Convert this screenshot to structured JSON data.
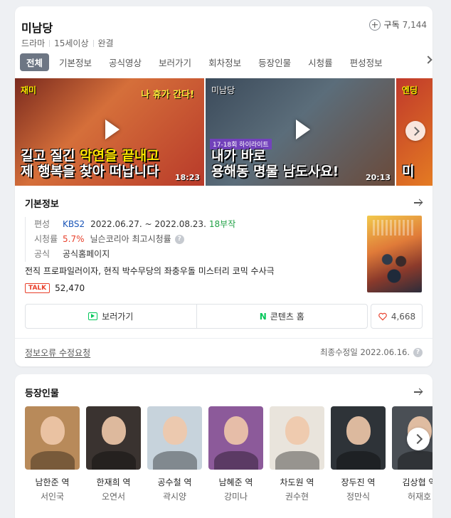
{
  "show": {
    "title": "미남당",
    "genre": "드라마",
    "rating": "15세이상",
    "status": "완결",
    "subscribe_label": "구독",
    "subscribe_count": "7,144"
  },
  "tabs": [
    "전체",
    "기본정보",
    "공식영상",
    "보러가기",
    "회차정보",
    "등장인물",
    "시청률",
    "편성정보"
  ],
  "videos": [
    {
      "tag": "재미",
      "top": "나 휴가 간다!",
      "caption_a": "길고 질긴 ",
      "caption_hl": "악연을 끝내고",
      "caption_b": "제 행복을 찾아 떠납니다",
      "duration": "18:23"
    },
    {
      "tag": "미남당",
      "badge": "17-18회 하이라이트",
      "caption_a": "내가 바로",
      "caption_b": "용해동 명물 남도사요!",
      "duration": "20:13"
    },
    {
      "tag": "엔딩",
      "caption_a": "미"
    }
  ],
  "basic_info": {
    "title": "기본정보",
    "broadcast_key": "편성",
    "broadcaster": "KBS2",
    "dates": "2022.06.27. ~ 2022.08.23.",
    "episodes": "18부작",
    "rating_key": "시청률",
    "rating_value": "5.7%",
    "rating_source": "닐슨코리아 최고시청률",
    "official_key": "공식",
    "official_link": "공식홈페이지",
    "description": "전직 프로파일러이자, 현직 박수무당의 좌충우돌 미스터리 코믹 수사극",
    "talk_badge": "TALK",
    "talk_count": "52,470",
    "watch_label": "보러가기",
    "content_home_label": "콘텐츠 홈",
    "naver_letter": "N",
    "like_count": "4,668",
    "report_label": "정보오류 수정요청",
    "updated_label": "최종수정일 2022.06.16."
  },
  "cast_section": {
    "title": "등장인물",
    "items": [
      {
        "role": "남한준 역",
        "actor": "서인국",
        "color": "#b88a5a"
      },
      {
        "role": "한재희 역",
        "actor": "오연서",
        "color": "#3a3330"
      },
      {
        "role": "공수철 역",
        "actor": "곽시양",
        "color": "#c7d3dc"
      },
      {
        "role": "남혜준 역",
        "actor": "강미나",
        "color": "#8c5a9a"
      },
      {
        "role": "차도원 역",
        "actor": "권수현",
        "color": "#e9e4dc"
      },
      {
        "role": "장두진 역",
        "actor": "정만식",
        "color": "#2e3338"
      },
      {
        "role": "김상협 역",
        "actor": "허재호",
        "color": "#4a4f55"
      }
    ]
  }
}
